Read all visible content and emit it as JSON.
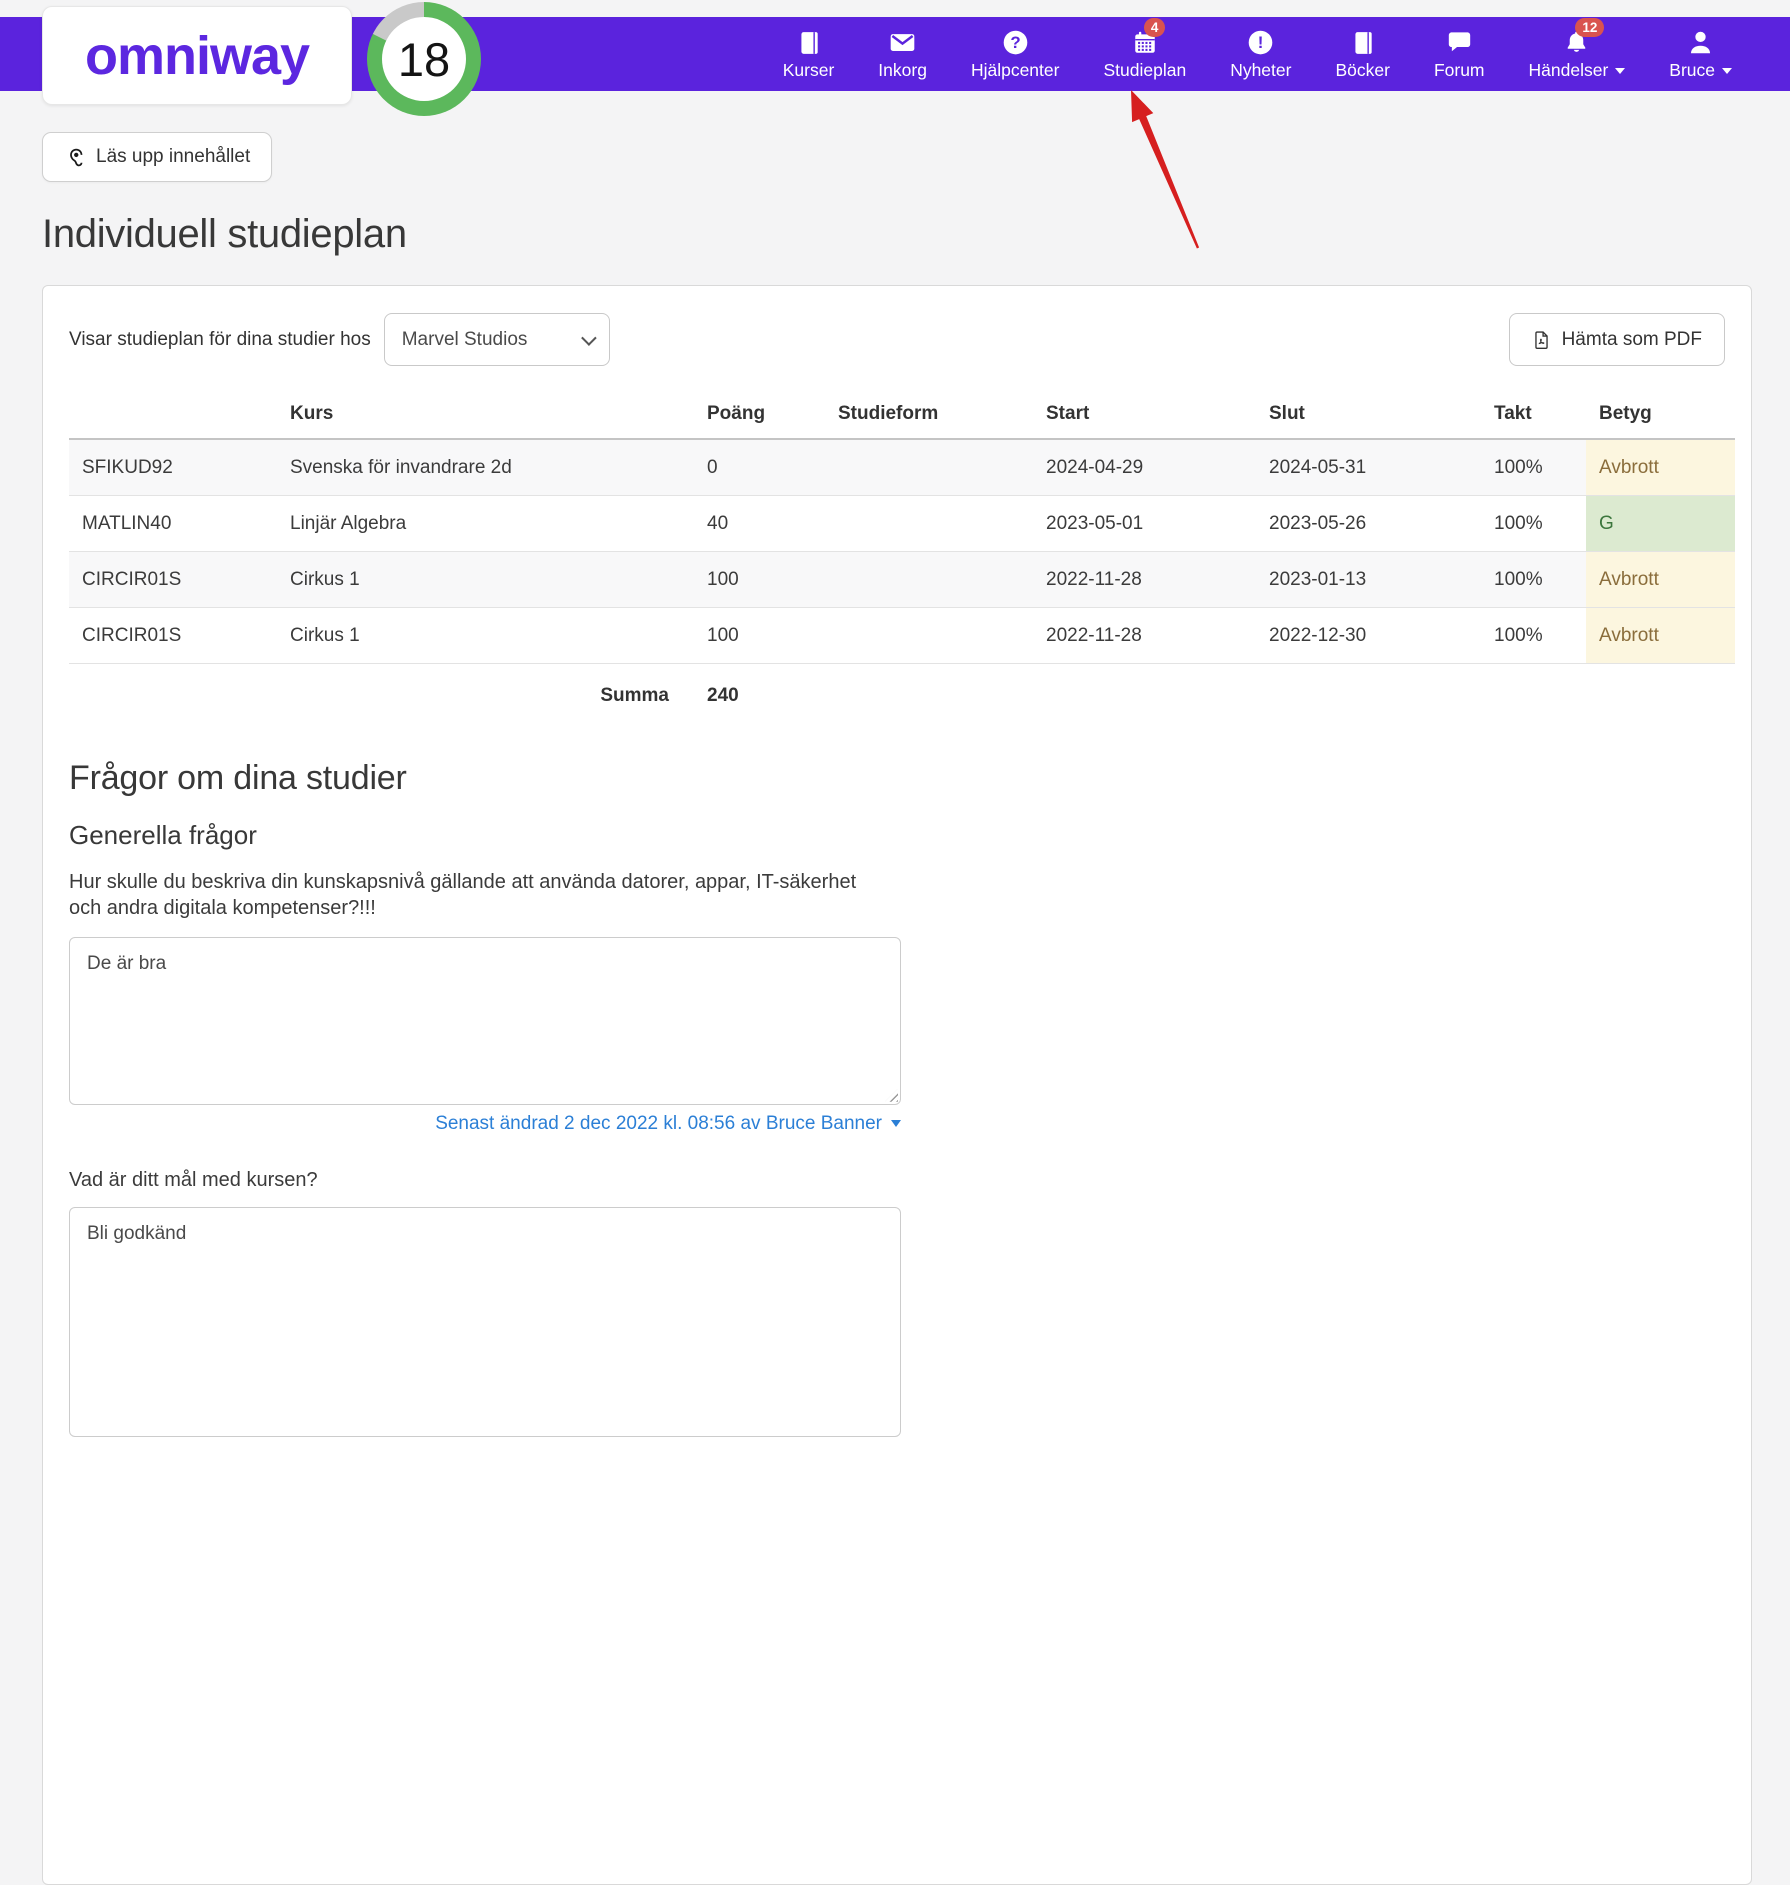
{
  "brand": {
    "logo_text": "omniway",
    "score_badge": "18"
  },
  "nav": {
    "items": [
      {
        "label": "Kurser",
        "icon": "book-icon"
      },
      {
        "label": "Inkorg",
        "icon": "envelope-icon"
      },
      {
        "label": "Hjälpcenter",
        "icon": "help-circle-icon"
      },
      {
        "label": "Studieplan",
        "icon": "calendar-icon",
        "badge": "4"
      },
      {
        "label": "Nyheter",
        "icon": "alert-circle-icon"
      },
      {
        "label": "Böcker",
        "icon": "book-icon"
      },
      {
        "label": "Forum",
        "icon": "chat-bubble-icon"
      },
      {
        "label": "Händelser",
        "icon": "bell-icon",
        "badge": "12"
      },
      {
        "label": "Bruce",
        "icon": "user-icon"
      }
    ]
  },
  "toolbar": {
    "read_aloud_label": "Läs upp innehållet"
  },
  "page": {
    "title": "Individuell studieplan"
  },
  "plan": {
    "filter_label": "Visar studieplan för dina studier hos",
    "provider_select_value": "Marvel Studios",
    "download_pdf_label": "Hämta som PDF",
    "table": {
      "headers": {
        "code": "",
        "kurs": "Kurs",
        "poang": "Poäng",
        "studieform": "Studieform",
        "start": "Start",
        "slut": "Slut",
        "takt": "Takt",
        "betyg": "Betyg"
      },
      "rows": [
        {
          "code": "SFIKUD92",
          "kurs": "Svenska för invandrare 2d",
          "poang": "0",
          "studieform": "",
          "start": "2024-04-29",
          "slut": "2024-05-31",
          "takt": "100%",
          "betyg": "Avbrott",
          "betyg_status": "warn"
        },
        {
          "code": "MATLIN40",
          "kurs": "Linjär Algebra",
          "poang": "40",
          "studieform": "",
          "start": "2023-05-01",
          "slut": "2023-05-26",
          "takt": "100%",
          "betyg": "G",
          "betyg_status": "ok"
        },
        {
          "code": "CIRCIR01S",
          "kurs": "Cirkus 1",
          "poang": "100",
          "studieform": "",
          "start": "2022-11-28",
          "slut": "2023-01-13",
          "takt": "100%",
          "betyg": "Avbrott",
          "betyg_status": "warn"
        },
        {
          "code": "CIRCIR01S",
          "kurs": "Cirkus 1",
          "poang": "100",
          "studieform": "",
          "start": "2022-11-28",
          "slut": "2022-12-30",
          "takt": "100%",
          "betyg": "Avbrott",
          "betyg_status": "warn"
        }
      ],
      "summary": {
        "label": "Summa",
        "total": "240"
      }
    }
  },
  "questions": {
    "section_title": "Frågor om dina studier",
    "group_title": "Generella frågor",
    "q1": {
      "text": "Hur skulle du beskriva din kunskapsnivå gällande att använda datorer, appar, IT-säkerhet och andra digitala kompetenser?!!!",
      "answer": "De är bra",
      "last_edited": "Senast ändrad 2 dec 2022 kl. 08:56 av Bruce Banner"
    },
    "q2": {
      "text": "Vad är ditt mål med kursen?",
      "answer": "Bli godkänd"
    }
  },
  "colors": {
    "header_purple": "#5b23dd",
    "badge_red": "#d9534f",
    "ring_green": "#5cb85c",
    "ring_gray": "#c9c9c9",
    "link_blue": "#2b7fd6",
    "grade_warn_bg": "#fcf6df",
    "grade_warn_text": "#8a6d3b",
    "grade_ok_bg": "#dcead0",
    "grade_ok_text": "#3c763d"
  }
}
